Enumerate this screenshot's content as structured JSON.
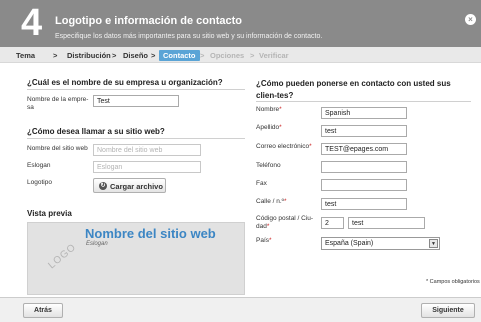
{
  "header": {
    "step_number": "4",
    "title": "Logotipo e información de contacto",
    "subtitle": "Especifique los datos más importantes para su sitio web y su información de contacto.",
    "close_glyph": "×"
  },
  "breadcrumb": {
    "separator": ">",
    "items": [
      {
        "label": "Tema",
        "state": "done"
      },
      {
        "label": "Distribución",
        "state": "done"
      },
      {
        "label": "Diseño",
        "state": "done"
      },
      {
        "label": "Contacto",
        "state": "active"
      },
      {
        "label": "Opciones",
        "state": "disabled"
      },
      {
        "label": "Verificar",
        "state": "disabled"
      }
    ]
  },
  "left": {
    "company_heading": "¿Cuál es el nombre de su empresa u organización?",
    "company_label": "Nombre de la empre-sa",
    "company_value": "Test",
    "site_heading": "¿Cómo desea llamar a su sitio web?",
    "site_name_label": "Nombre del sitio web",
    "site_name_placeholder": "Nombre del sitio web",
    "slogan_label": "Eslogan",
    "slogan_placeholder": "Eslogan",
    "logo_label": "Logotipo",
    "upload_button": "Cargar archivo",
    "upload_icon": "upload-icon"
  },
  "preview": {
    "title": "Vista previa",
    "logo_text": "LOGO",
    "site_name": "Nombre del sitio web",
    "slogan": "Eslogan"
  },
  "right": {
    "heading": "¿Cómo pueden ponerse en contacto con usted sus clien-tes?",
    "required_marker": "*",
    "fields": {
      "first_name": {
        "label": "Nombre",
        "value": "Spanish",
        "required": true
      },
      "last_name": {
        "label": "Apellido",
        "value": "test",
        "required": true
      },
      "email": {
        "label": "Correo electrónico",
        "value": "TEST@epages.com",
        "required": true
      },
      "phone": {
        "label": "Teléfono",
        "value": "",
        "required": false
      },
      "fax": {
        "label": "Fax",
        "value": "",
        "required": false
      },
      "street": {
        "label": "Calle / n.º",
        "value": "test",
        "required": true
      },
      "postal_code": {
        "label": "Código postal / Ciu-dad",
        "value": "2",
        "required": true
      },
      "city": {
        "value": "test"
      },
      "country": {
        "label": "País",
        "value": "España (Spain)",
        "required": true,
        "arrow": "▼"
      }
    },
    "required_note": "* Campos obligatorios"
  },
  "footer": {
    "back_button": "Atrás",
    "next_button": "Siguiente"
  },
  "colors": {
    "header_bg": "#8a8a8a",
    "active_step": "#5aa4d6",
    "preview_site_name": "#3c86c4",
    "required": "#cc2222"
  }
}
